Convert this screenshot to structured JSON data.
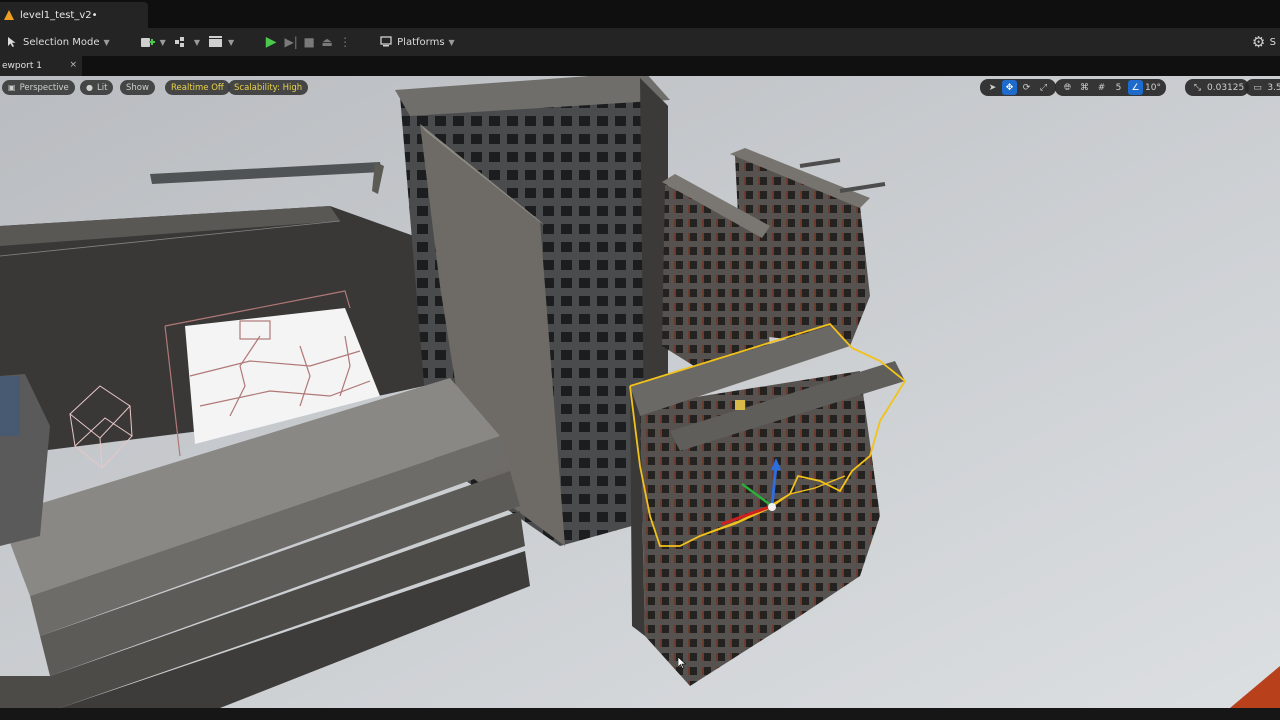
{
  "window": {
    "level_tab": "level1_test_v2•"
  },
  "toolbar": {
    "selection_mode": "Selection Mode",
    "platforms": "Platforms",
    "settings_label": "S"
  },
  "viewport_tab": {
    "label": "ewport 1",
    "close": "×"
  },
  "viewport_overlay": {
    "perspective": "Perspective",
    "lit": "Lit",
    "show": "Show",
    "realtime": "Realtime Off",
    "scalability": "Scalability: High",
    "grid_size": "5",
    "rotation_snap": "10°",
    "scale_snap": "0.03125",
    "camera_speed": "3.5"
  },
  "icons": {
    "ue_logo": "unreal-warning-icon",
    "add": "add-actor-icon",
    "blueprint": "blueprint-icon",
    "cinematics": "cinematics-icon",
    "play": "play-icon",
    "advance": "advance-frame-icon",
    "stop": "stop-icon",
    "eject": "eject-icon",
    "more": "more-options-icon",
    "platforms": "platforms-icon",
    "settings": "settings-gear-icon"
  },
  "colors": {
    "accent_blue": "#1f6bcc",
    "selection_outline": "#f2c21b",
    "play_green": "#4cc94c",
    "panel_bg": "#242424"
  }
}
